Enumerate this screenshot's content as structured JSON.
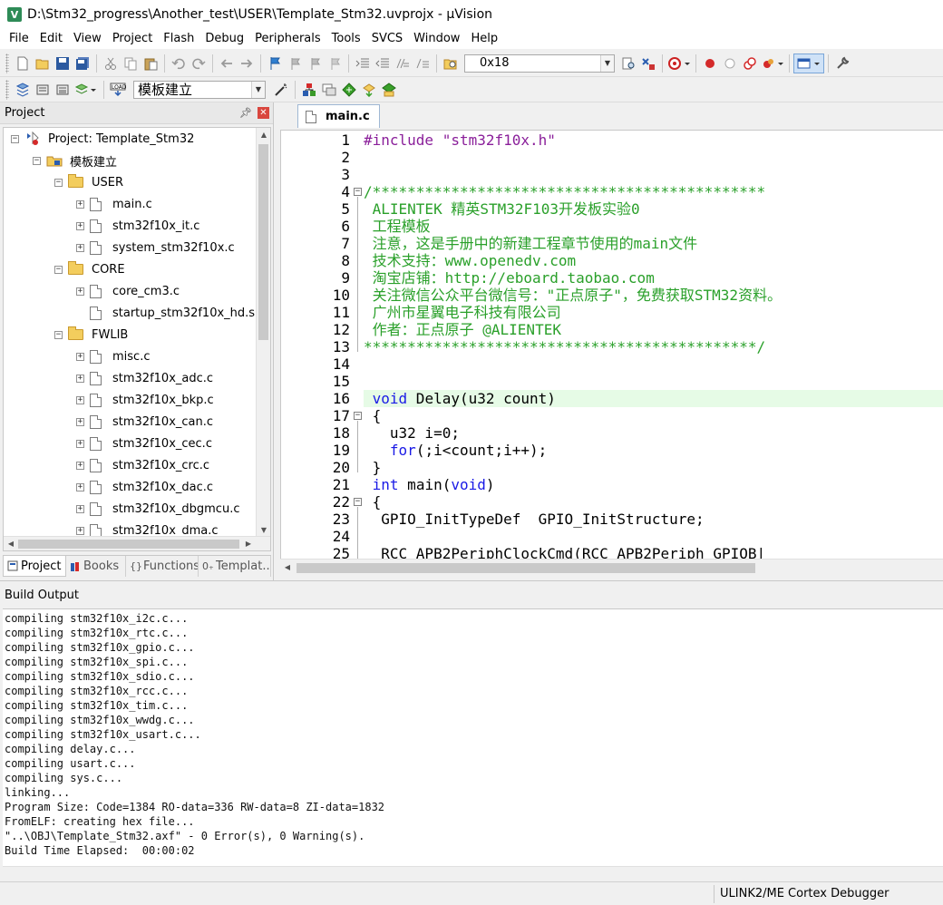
{
  "window": {
    "title": "D:\\Stm32_progress\\Another_test\\USER\\Template_Stm32.uvprojx - µVision"
  },
  "menu": [
    "File",
    "Edit",
    "View",
    "Project",
    "Flash",
    "Debug",
    "Peripherals",
    "Tools",
    "SVCS",
    "Window",
    "Help"
  ],
  "toolbar": {
    "find_combo_value": "0x18",
    "target_combo_value": "模板建立"
  },
  "project_panel": {
    "title": "Project",
    "tree": [
      {
        "label": "Project: Template_Stm32",
        "level": 0,
        "type": "project",
        "expander": "−"
      },
      {
        "label": "模板建立",
        "level": 1,
        "type": "target",
        "expander": "−"
      },
      {
        "label": "USER",
        "level": 2,
        "type": "folder",
        "expander": "−"
      },
      {
        "label": "main.c",
        "level": 3,
        "type": "file",
        "expander": "+"
      },
      {
        "label": "stm32f10x_it.c",
        "level": 3,
        "type": "file",
        "expander": "+"
      },
      {
        "label": "system_stm32f10x.c",
        "level": 3,
        "type": "file",
        "expander": "+"
      },
      {
        "label": "CORE",
        "level": 2,
        "type": "folder",
        "expander": "−"
      },
      {
        "label": "core_cm3.c",
        "level": 3,
        "type": "file",
        "expander": "+"
      },
      {
        "label": "startup_stm32f10x_hd.s",
        "level": 3,
        "type": "file",
        "expander": ""
      },
      {
        "label": "FWLIB",
        "level": 2,
        "type": "folder",
        "expander": "−"
      },
      {
        "label": "misc.c",
        "level": 3,
        "type": "file",
        "expander": "+"
      },
      {
        "label": "stm32f10x_adc.c",
        "level": 3,
        "type": "file",
        "expander": "+"
      },
      {
        "label": "stm32f10x_bkp.c",
        "level": 3,
        "type": "file",
        "expander": "+"
      },
      {
        "label": "stm32f10x_can.c",
        "level": 3,
        "type": "file",
        "expander": "+"
      },
      {
        "label": "stm32f10x_cec.c",
        "level": 3,
        "type": "file",
        "expander": "+"
      },
      {
        "label": "stm32f10x_crc.c",
        "level": 3,
        "type": "file",
        "expander": "+"
      },
      {
        "label": "stm32f10x_dac.c",
        "level": 3,
        "type": "file",
        "expander": "+"
      },
      {
        "label": "stm32f10x_dbgmcu.c",
        "level": 3,
        "type": "file",
        "expander": "+"
      },
      {
        "label": "stm32f10x_dma.c",
        "level": 3,
        "type": "file",
        "expander": "+"
      }
    ],
    "tabs": [
      "Project",
      "Books",
      "Functions",
      "Templat..."
    ]
  },
  "editor": {
    "active_tab": "main.c",
    "lines": [
      {
        "no": "1",
        "text": "#include \"stm32f10x.h\"",
        "kind": "pp",
        "fold": ""
      },
      {
        "no": "2",
        "text": "",
        "kind": "",
        "fold": ""
      },
      {
        "no": "3",
        "text": "",
        "kind": "",
        "fold": ""
      },
      {
        "no": "4",
        "text": "/*********************************************",
        "kind": "comment",
        "fold": "−"
      },
      {
        "no": "5",
        "text": " ALIENTEK 精英STM32F103开发板实验0",
        "kind": "comment",
        "fold": ""
      },
      {
        "no": "6",
        "text": " 工程模板",
        "kind": "comment",
        "fold": ""
      },
      {
        "no": "7",
        "text": " 注意，这是手册中的新建工程章节使用的main文件",
        "kind": "comment",
        "fold": ""
      },
      {
        "no": "8",
        "text": " 技术支持：www.openedv.com",
        "kind": "comment",
        "fold": ""
      },
      {
        "no": "9",
        "text": " 淘宝店铺：http://eboard.taobao.com",
        "kind": "comment",
        "fold": ""
      },
      {
        "no": "10",
        "text": " 关注微信公众平台微信号：\"正点原子\"，免费获取STM32资料。",
        "kind": "comment",
        "fold": ""
      },
      {
        "no": "11",
        "text": " 广州市星翼电子科技有限公司",
        "kind": "comment",
        "fold": ""
      },
      {
        "no": "12",
        "text": " 作者：正点原子 @ALIENTEK",
        "kind": "comment",
        "fold": ""
      },
      {
        "no": "13",
        "text": "*********************************************/",
        "kind": "comment",
        "fold": ""
      },
      {
        "no": "14",
        "text": "",
        "kind": "",
        "fold": ""
      },
      {
        "no": "15",
        "text": "",
        "kind": "",
        "fold": ""
      },
      {
        "no": "16",
        "text": " void Delay(u32 count)",
        "kind": "code",
        "fold": "",
        "highlight": true
      },
      {
        "no": "17",
        "text": " {",
        "kind": "code",
        "fold": "−"
      },
      {
        "no": "18",
        "text": "   u32 i=0;",
        "kind": "code",
        "fold": ""
      },
      {
        "no": "19",
        "text": "   for(;i<count;i++);",
        "kind": "code",
        "fold": ""
      },
      {
        "no": "20",
        "text": " }",
        "kind": "code",
        "fold": ""
      },
      {
        "no": "21",
        "text": " int main(void)",
        "kind": "code",
        "fold": ""
      },
      {
        "no": "22",
        "text": " {",
        "kind": "code",
        "fold": "−"
      },
      {
        "no": "23",
        "text": "  GPIO_InitTypeDef  GPIO_InitStructure;",
        "kind": "code",
        "fold": ""
      },
      {
        "no": "24",
        "text": "",
        "kind": "",
        "fold": ""
      },
      {
        "no": "25",
        "text": "  RCC_APB2PeriphClockCmd(RCC_APB2Periph_GPIOB|",
        "kind": "code",
        "fold": ""
      }
    ]
  },
  "build_output": {
    "title": "Build Output",
    "lines": [
      "compiling stm32f10x_i2c.c...",
      "compiling stm32f10x_rtc.c...",
      "compiling stm32f10x_gpio.c...",
      "compiling stm32f10x_spi.c...",
      "compiling stm32f10x_sdio.c...",
      "compiling stm32f10x_rcc.c...",
      "compiling stm32f10x_tim.c...",
      "compiling stm32f10x_wwdg.c...",
      "compiling stm32f10x_usart.c...",
      "compiling delay.c...",
      "compiling usart.c...",
      "compiling sys.c...",
      "linking...",
      "Program Size: Code=1384 RO-data=336 RW-data=8 ZI-data=1832",
      "FromELF: creating hex file...",
      "\"..\\OBJ\\Template_Stm32.axf\" - 0 Error(s), 0 Warning(s).",
      "Build Time Elapsed:  00:00:02"
    ]
  },
  "status": {
    "debugger": "ULINK2/ME Cortex Debugger"
  },
  "colors": {
    "comment": "#2aa02a",
    "keyword": "#1a1ae6",
    "preprocessor": "#8a1f9a",
    "current_line": "#e6fbe6"
  }
}
